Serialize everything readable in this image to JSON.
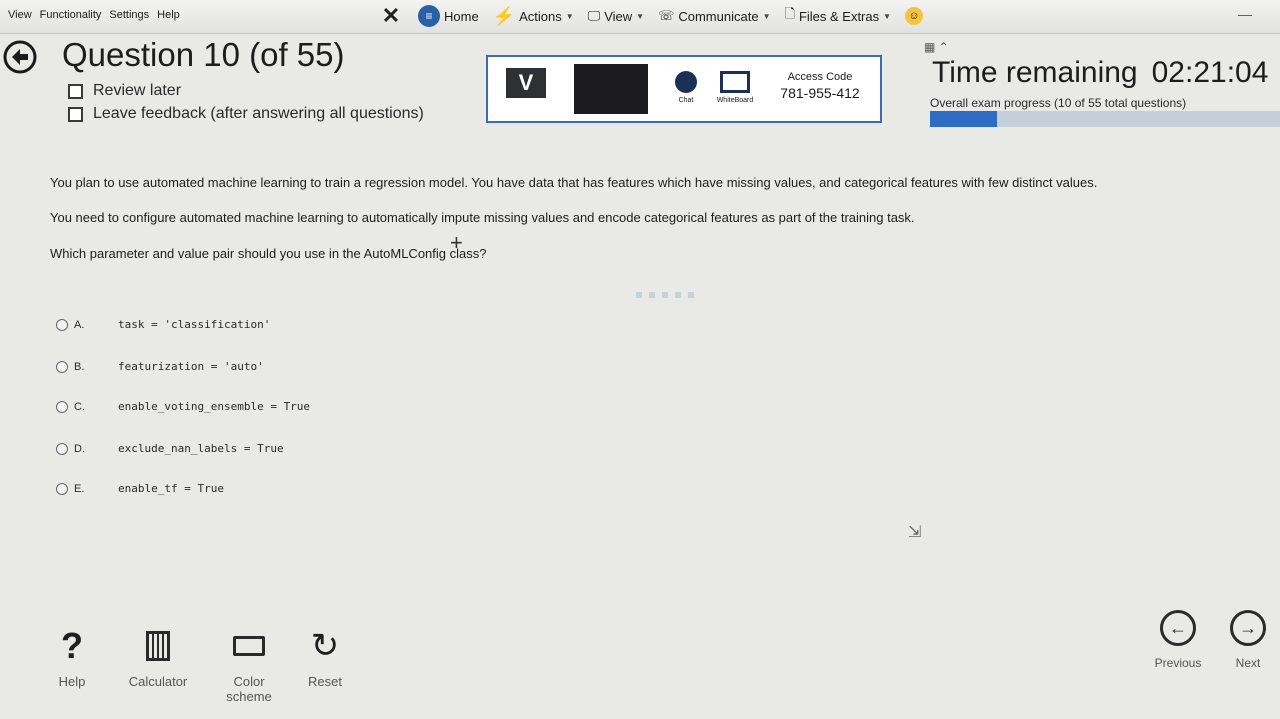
{
  "menu": [
    "View",
    "Functionality",
    "Settings",
    "Help"
  ],
  "toolbar": {
    "home": "Home",
    "actions": "Actions",
    "view": "View",
    "communicate": "Communicate",
    "files": "Files & Extras"
  },
  "header": {
    "question_title": "Question 10 (of 55)",
    "review_later": "Review later",
    "leave_feedback": "Leave feedback (after answering all questions)"
  },
  "session": {
    "logo": "V",
    "chat": "Chat",
    "whiteboard": "WhiteBoard",
    "access_label": "Access Code",
    "access_code": "781-955-412"
  },
  "timer": {
    "label": "Time remaining",
    "value": "02:21:04",
    "progress_text": "Overall exam progress (10 of 55 total questions)",
    "progress_fraction": 0.19
  },
  "question": {
    "p1": "You plan to use automated machine learning to train a regression model. You have data that has features which have missing values, and categorical features with few distinct values.",
    "p2": "You need to configure automated machine learning to automatically impute missing values and encode categorical features as part of the training task.",
    "p3": "Which parameter and value pair should you use in the AutoMLConfig class?"
  },
  "options": [
    {
      "letter": "A.",
      "code": "task = 'classification'"
    },
    {
      "letter": "B.",
      "code": "featurization = 'auto'"
    },
    {
      "letter": "C.",
      "code": "enable_voting_ensemble = True"
    },
    {
      "letter": "D.",
      "code": "exclude_nan_labels = True"
    },
    {
      "letter": "E.",
      "code": "enable_tf = True"
    }
  ],
  "tools": {
    "help": "Help",
    "calculator": "Calculator",
    "color_scheme": "Color scheme",
    "reset": "Reset"
  },
  "nav": {
    "previous": "Previous",
    "next": "Next"
  }
}
